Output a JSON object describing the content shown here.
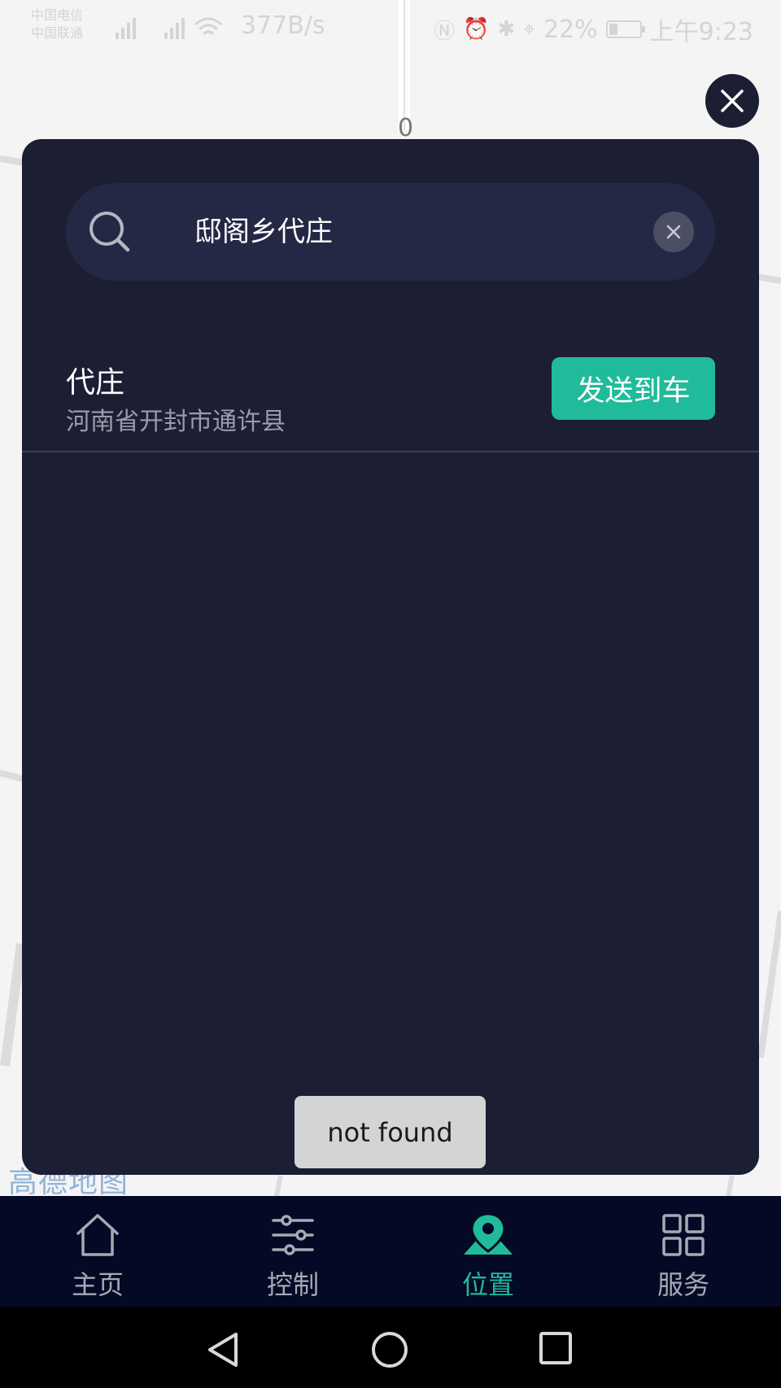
{
  "status_bar": {
    "carrier_1": "中国电信",
    "carrier_2": "中国联通",
    "network_speed": "377B/s",
    "battery": "22%",
    "time": "上午9:23"
  },
  "map": {
    "scale_label": "0",
    "logo_text": "高德地图"
  },
  "search": {
    "query": "邸阁乡代庄"
  },
  "results": [
    {
      "name": "代庄",
      "address": "河南省开封市通许县",
      "action_label": "发送到车"
    }
  ],
  "toast": "not found",
  "tabs": [
    {
      "label": "主页",
      "icon": "home-icon",
      "active": false
    },
    {
      "label": "控制",
      "icon": "sliders-icon",
      "active": false
    },
    {
      "label": "位置",
      "icon": "location-pin-icon",
      "active": true
    },
    {
      "label": "服务",
      "icon": "grid-icon",
      "active": false
    }
  ],
  "colors": {
    "accent": "#1fbb9a",
    "panel": "#1c1f33",
    "tabbar": "#040a26"
  }
}
